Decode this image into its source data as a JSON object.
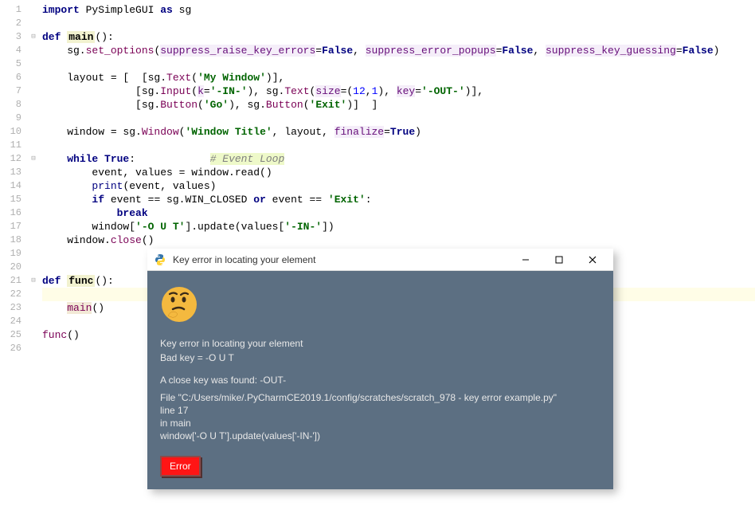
{
  "gutter": [
    "1",
    "2",
    "3",
    "4",
    "5",
    "6",
    "7",
    "8",
    "9",
    "10",
    "11",
    "12",
    "13",
    "14",
    "15",
    "16",
    "17",
    "18",
    "19",
    "20",
    "21",
    "22",
    "23",
    "24",
    "25",
    "26"
  ],
  "code": {
    "l1_kw": "import",
    "l1_mod": " PySimpleGUI ",
    "l1_as": "as",
    "l1_alias": " sg",
    "l3_def": "def ",
    "l3_name": "main",
    "l3_par": "():",
    "l4_pre": "    sg.",
    "l4_fn": "set_options",
    "l4_p1": "(",
    "l4_a1": "suppress_raise_key_errors",
    "l4_e1": "=",
    "l4_v1": "False",
    "l4_c1": ", ",
    "l4_a2": "suppress_error_popups",
    "l4_e2": "=",
    "l4_v2": "False",
    "l4_c2": ", ",
    "l4_a3": "suppress_key_guessing",
    "l4_e3": "=",
    "l4_v3": "False",
    "l4_p2": ")",
    "l6_pre": "    layout = [  [sg.",
    "l6_fn": "Text",
    "l6_p1": "(",
    "l6_s": "'My Window'",
    "l6_p2": ")],",
    "l7_pre": "               [sg.",
    "l7_fn1": "Input",
    "l7_p1": "(",
    "l7_a1": "k",
    "l7_e1": "=",
    "l7_s1": "'-IN-'",
    "l7_p2": "), sg.",
    "l7_fn2": "Text",
    "l7_p3": "(",
    "l7_a2": "size",
    "l7_e2": "=(",
    "l7_n1": "12",
    "l7_c1": ",",
    "l7_n2": "1",
    "l7_p4": "), ",
    "l7_a3": "key",
    "l7_e3": "=",
    "l7_s2": "'-OUT-'",
    "l7_p5": ")],",
    "l8_pre": "               [sg.",
    "l8_fn1": "Button",
    "l8_p1": "(",
    "l8_s1": "'Go'",
    "l8_p2": "), sg.",
    "l8_fn2": "Button",
    "l8_p3": "(",
    "l8_s2": "'Exit'",
    "l8_p4": ")]  ]",
    "l10_pre": "    window = sg.",
    "l10_fn": "Window",
    "l10_p1": "(",
    "l10_s": "'Window Title'",
    "l10_c": ", layout, ",
    "l10_a": "finalize",
    "l10_e": "=",
    "l10_v": "True",
    "l10_p2": ")",
    "l12_pre": "    ",
    "l12_kw": "while ",
    "l12_v": "True",
    "l12_col": ":            ",
    "l12_cm": "# Event Loop",
    "l13": "        event, values = window.read()",
    "l14_pre": "        ",
    "l14_fn": "print",
    "l14_rest": "(event, values)",
    "l15_pre": "        ",
    "l15_if": "if",
    "l15_m": " event == sg.WIN_CLOSED ",
    "l15_or": "or",
    "l15_m2": " event == ",
    "l15_s": "'Exit'",
    "l15_col": ":",
    "l16_pre": "            ",
    "l16_br": "break",
    "l17_pre": "        window[",
    "l17_s1": "'-O U T'",
    "l17_m": "].update(values[",
    "l17_s2": "'-IN-'",
    "l17_p": "])",
    "l18_pre": "    window.",
    "l18_fn": "close",
    "l18_p": "()",
    "l21_def": "def ",
    "l21_name": "func",
    "l21_par": "():",
    "l23_pre": "    ",
    "l23_fn": "main",
    "l23_p": "()",
    "l25_fn": "func",
    "l25_p": "()"
  },
  "popup": {
    "title": "Key error in locating your element",
    "msg1": "Key error in locating your element",
    "msg2": "Bad key = -O U T",
    "msg3": "A close key was found: -OUT-",
    "tb1": "  File \"C:/Users/mike/.PyCharmCE2019.1/config/scratches/scratch_978 - key error example.py\"",
    "tb2": "line 17",
    "tb3": "in main",
    "tb4": "    window['-O U T'].update(values['-IN-'])",
    "button": "Error"
  }
}
